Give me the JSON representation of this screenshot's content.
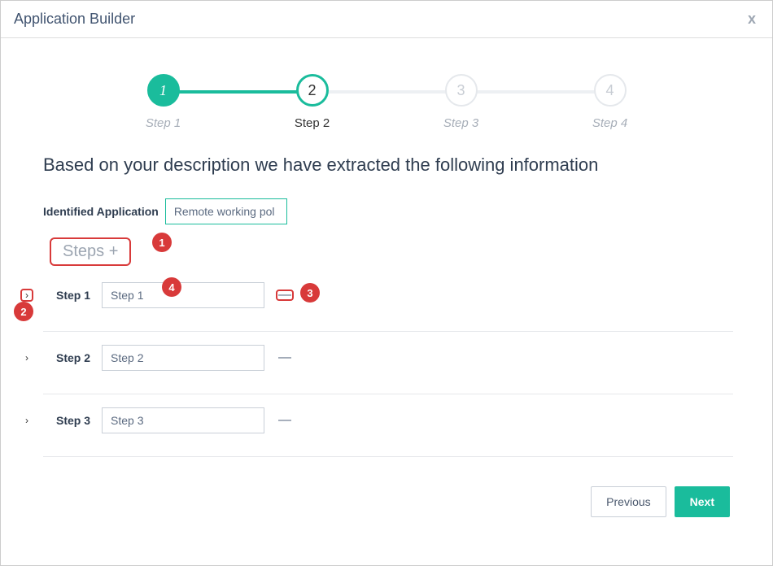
{
  "header": {
    "title": "Application Builder",
    "close": "x"
  },
  "stepper": [
    {
      "num": "1",
      "label": "Step 1",
      "state": "done"
    },
    {
      "num": "2",
      "label": "Step 2",
      "state": "current"
    },
    {
      "num": "3",
      "label": "Step 3",
      "state": "pending"
    },
    {
      "num": "4",
      "label": "Step 4",
      "state": "pending"
    }
  ],
  "heading": "Based on your description we have extracted the following information",
  "identified": {
    "label": "Identified Application",
    "value": "Remote working pol"
  },
  "steps_header": {
    "text": "Steps",
    "plus": "+"
  },
  "rows": [
    {
      "label": "Step 1",
      "value": "Step 1",
      "chev_boxed": true,
      "minus_boxed": true
    },
    {
      "label": "Step 2",
      "value": "Step 2",
      "chev_boxed": false,
      "minus_boxed": false
    },
    {
      "label": "Step 3",
      "value": "Step 3",
      "chev_boxed": false,
      "minus_boxed": false
    }
  ],
  "annotations": {
    "a1": "1",
    "a2": "2",
    "a3": "3",
    "a4": "4"
  },
  "actions": {
    "previous": "Previous",
    "next": "Next"
  },
  "minus": "—",
  "chev": "›"
}
